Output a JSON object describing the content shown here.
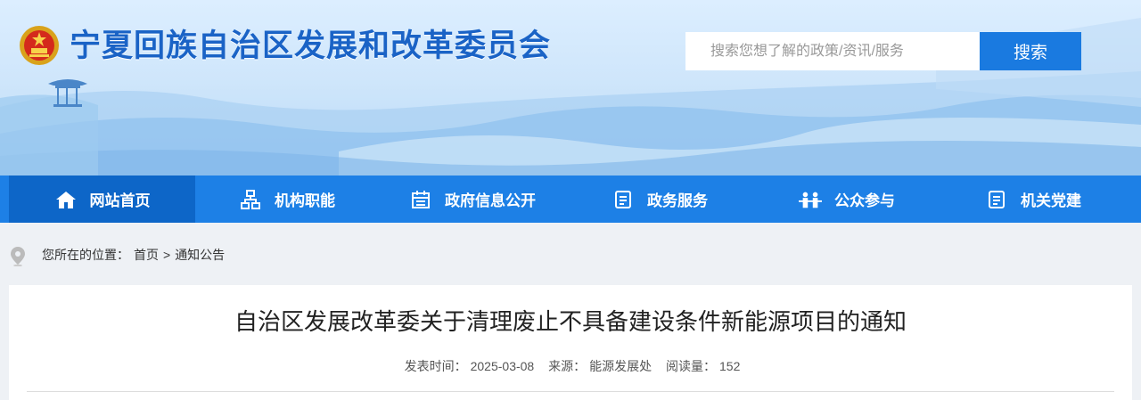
{
  "header": {
    "site_title": "宁夏回族自治区发展和改革委员会",
    "search_placeholder": "搜索您想了解的政策/资讯/服务",
    "search_button": "搜索"
  },
  "nav": {
    "items": [
      {
        "label": "网站首页",
        "icon": "home-icon",
        "active": true
      },
      {
        "label": "机构职能",
        "icon": "org-chart-icon"
      },
      {
        "label": "政府信息公开",
        "icon": "calendar-icon"
      },
      {
        "label": "政务服务",
        "icon": "document-icon"
      },
      {
        "label": "公众参与",
        "icon": "people-icon"
      },
      {
        "label": "机关党建",
        "icon": "document-icon"
      }
    ]
  },
  "breadcrumb": {
    "prefix": "您所在的位置：",
    "home": "首页",
    "separator": ">",
    "current": "通知公告"
  },
  "article": {
    "title": "自治区发展改革委关于清理废止不具备建设条件新能源项目的通知",
    "publish_label": "发表时间：",
    "publish_date": "2025-03-08",
    "source_label": "来源：",
    "source": "能源发展处",
    "views_label": "阅读量：",
    "views": "152"
  },
  "colors": {
    "nav_bg": "#1d80e6",
    "nav_active": "#0d66c8",
    "title_blue": "#1a63c6",
    "search_button": "#1a7ae0"
  }
}
